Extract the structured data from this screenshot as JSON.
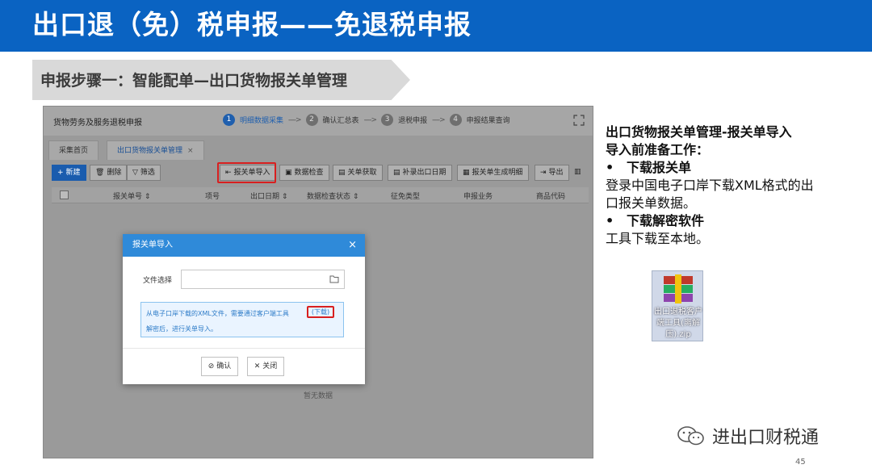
{
  "slide": {
    "title": "出口退（免）税申报——免退税申报",
    "step_banner": "申报步骤一：智能配单—出口货物报关单管理",
    "page_number": "45",
    "watermark": "进出口财税通"
  },
  "app": {
    "title": "货物劳务及服务退税申报",
    "wizard": [
      {
        "num": "1",
        "label": "明细数据采集",
        "active": true
      },
      {
        "num": "2",
        "label": "确认汇总表",
        "active": false
      },
      {
        "num": "3",
        "label": "退税申报",
        "active": false
      },
      {
        "num": "4",
        "label": "申报结果查询",
        "active": false
      }
    ],
    "tabs": [
      {
        "label": "采集首页"
      },
      {
        "label": "出口货物报关单管理",
        "close": "×"
      }
    ],
    "toolbar": {
      "new": "新建",
      "delete": "删除",
      "filter": "筛选",
      "import": "报关单导入",
      "check": "数据检查",
      "fetch": "关单获取",
      "supplement": "补录出口日期",
      "generate": "报关单生成明细",
      "export": "导出"
    },
    "columns": [
      "报关单号",
      "项号",
      "出口日期",
      "数据检查状态",
      "征免类型",
      "申报业务",
      "商品代码"
    ],
    "empty_text": "暂无数据"
  },
  "dialog": {
    "title": "报关单导入",
    "file_label": "文件选择",
    "note_line1": "从电子口岸下载的XML文件，需要通过客户端工具",
    "download_link": "(下载)",
    "note_line2": "解密后，进行关单导入。",
    "ok_label": "确认",
    "close_label": "关闭"
  },
  "right_panel": {
    "heading1": "出口货物报关单管理-报关单导入",
    "heading2": "导入前准备工作：",
    "bullet1": "下载报关单",
    "text1_line1": "登录中国电子口岸下载XML格式的出",
    "text1_line2": "口报关单数据。",
    "bullet2": "下载解密软件",
    "text2": "工具下载至本地。",
    "file_label": "出口退税客户端工具(离解压).zip"
  }
}
